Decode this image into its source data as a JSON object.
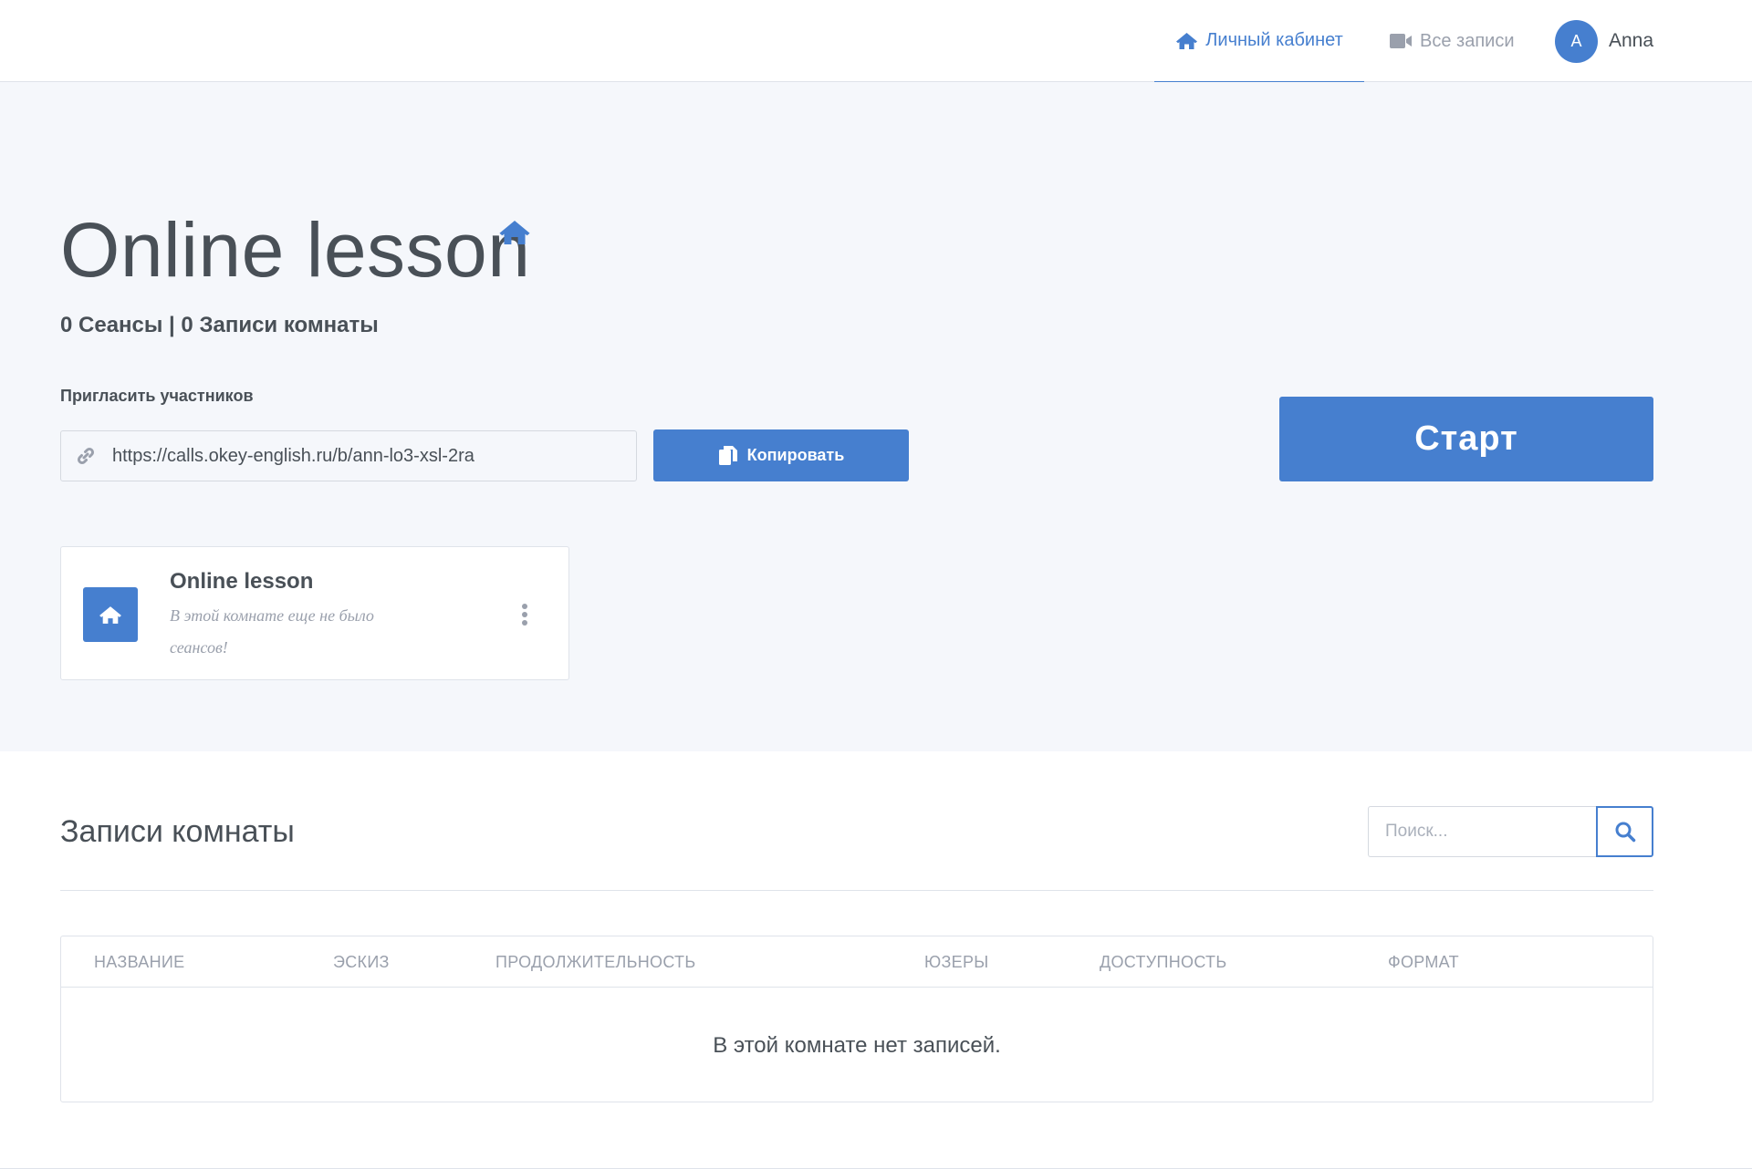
{
  "nav": {
    "home_label": "Личный кабинет",
    "home_icon": "home-icon",
    "records_label": "Все записи",
    "records_icon": "video-camera-icon",
    "user_initial": "A",
    "user_name": "Anna"
  },
  "room": {
    "title": "Online lesson",
    "title_icon": "home-icon",
    "stats": "0 Сеансы | 0 Записи комнаты",
    "invite_label": "Пригласить участников",
    "invite_link": "https://calls.okey-english.ru/b/ann-lo3-xsl-2ra",
    "copy_label": "Копировать",
    "start_label": "Старт"
  },
  "room_card": {
    "name": "Online lesson",
    "description": "В этой комнате еще не было сеансов!"
  },
  "records": {
    "title": "Записи комнаты",
    "search_placeholder": "Поиск...",
    "columns": [
      "Название",
      "Эскиз",
      "Продолжительность",
      "Юзеры",
      "Доступность",
      "Формат"
    ],
    "empty_message": "В этой комнате нет записей."
  },
  "colors": {
    "accent": "#467fcf",
    "background": "#f5f7fb",
    "text": "#495057",
    "muted": "#9aa0ac"
  }
}
